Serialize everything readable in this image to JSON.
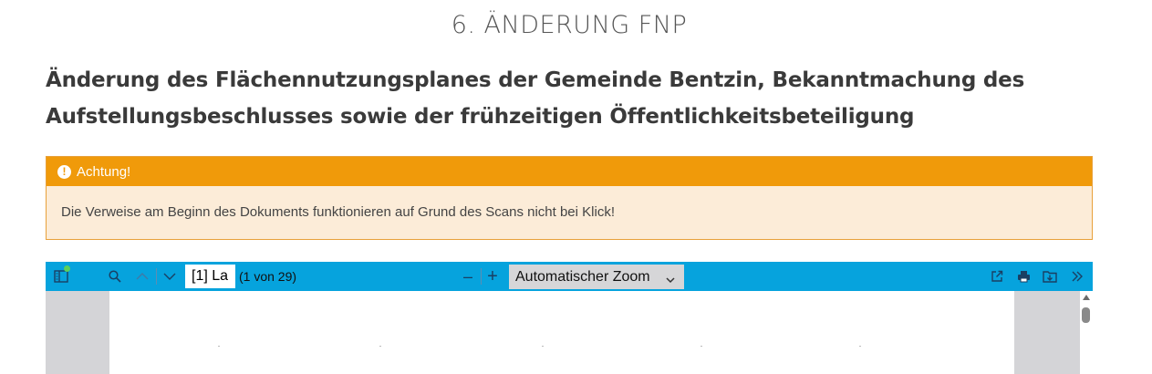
{
  "page": {
    "title": "6. ÄNDERUNG FNP",
    "headline": "Änderung des Flächennutzungsplanes der Gemeinde Bentzin, Bekanntmachung des Aufstellungsbeschlusses sowie der frühzeitigen Öffentlichkeitsbeteiligung"
  },
  "alert": {
    "icon": "exclamation-icon",
    "title": "Achtung!",
    "message": "Die Verweise am Beginn des Dokuments funktionieren auf Grund des Scans nicht bei Klick!",
    "colors": {
      "header": "#f09a0a",
      "body": "#fcecd8",
      "border": "#e8a13b"
    }
  },
  "viewer": {
    "toolbar_color": "#06a3dd",
    "page_input_value": "[1] La",
    "page_count": "(1 von 29)",
    "zoom_minus": "–",
    "zoom_plus": "+",
    "zoom_value": "Automatischer Zoom",
    "icons": [
      "sidebar-toggle-icon",
      "search-icon",
      "previous-page-icon",
      "next-page-icon",
      "zoom-out-icon",
      "zoom-in-icon",
      "chevron-down-icon",
      "open-external-icon",
      "print-icon",
      "download-icon",
      "tools-menu-icon"
    ]
  }
}
